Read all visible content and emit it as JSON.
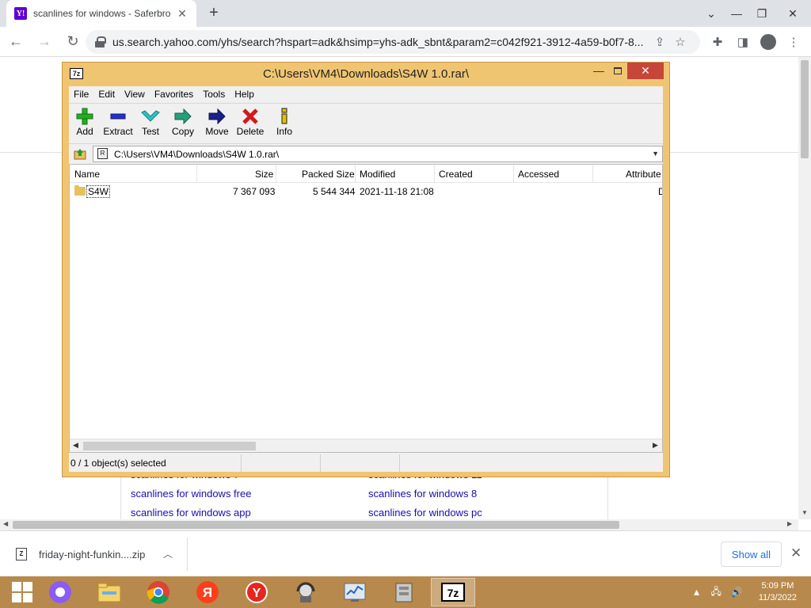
{
  "browser": {
    "tab_title": "scanlines for windows - Saferbro",
    "tab_favicon": "Y!",
    "new_tab": "+",
    "url": "us.search.yahoo.com/yhs/search?hspart=adk&hsimp=yhs-adk_sbnt&param2=c042f921-3912-4a59-b0f7-8...",
    "accent": "#6001d2"
  },
  "page": {
    "related": [
      "scanlines for windows 7",
      "scanlines for windows 11",
      "scanlines for windows free",
      "scanlines for windows 8",
      "scanlines for windows app",
      "scanlines for windows pc"
    ]
  },
  "downloads": {
    "file_name": "friday-night-funkin....zip",
    "show_all": "Show all"
  },
  "zip": {
    "title": "C:\\Users\\VM4\\Downloads\\S4W 1.0.rar\\",
    "logo": "7z",
    "menu": [
      "File",
      "Edit",
      "View",
      "Favorites",
      "Tools",
      "Help"
    ],
    "tools": [
      "Add",
      "Extract",
      "Test",
      "Copy",
      "Move",
      "Delete",
      "Info"
    ],
    "path": "C:\\Users\\VM4\\Downloads\\S4W 1.0.rar\\",
    "columns": [
      "Name",
      "Size",
      "Packed Size",
      "Modified",
      "Created",
      "Accessed",
      "Attribute"
    ],
    "row": {
      "name": "S4W",
      "size": "7 367 093",
      "packed": "5 544 344",
      "modified": "2021-11-18 21:08",
      "attr": "D"
    },
    "status": "0 / 1 object(s) selected"
  },
  "taskbar": {
    "time": "5:09 PM",
    "date": "11/3/2022",
    "active_label": "7z"
  }
}
